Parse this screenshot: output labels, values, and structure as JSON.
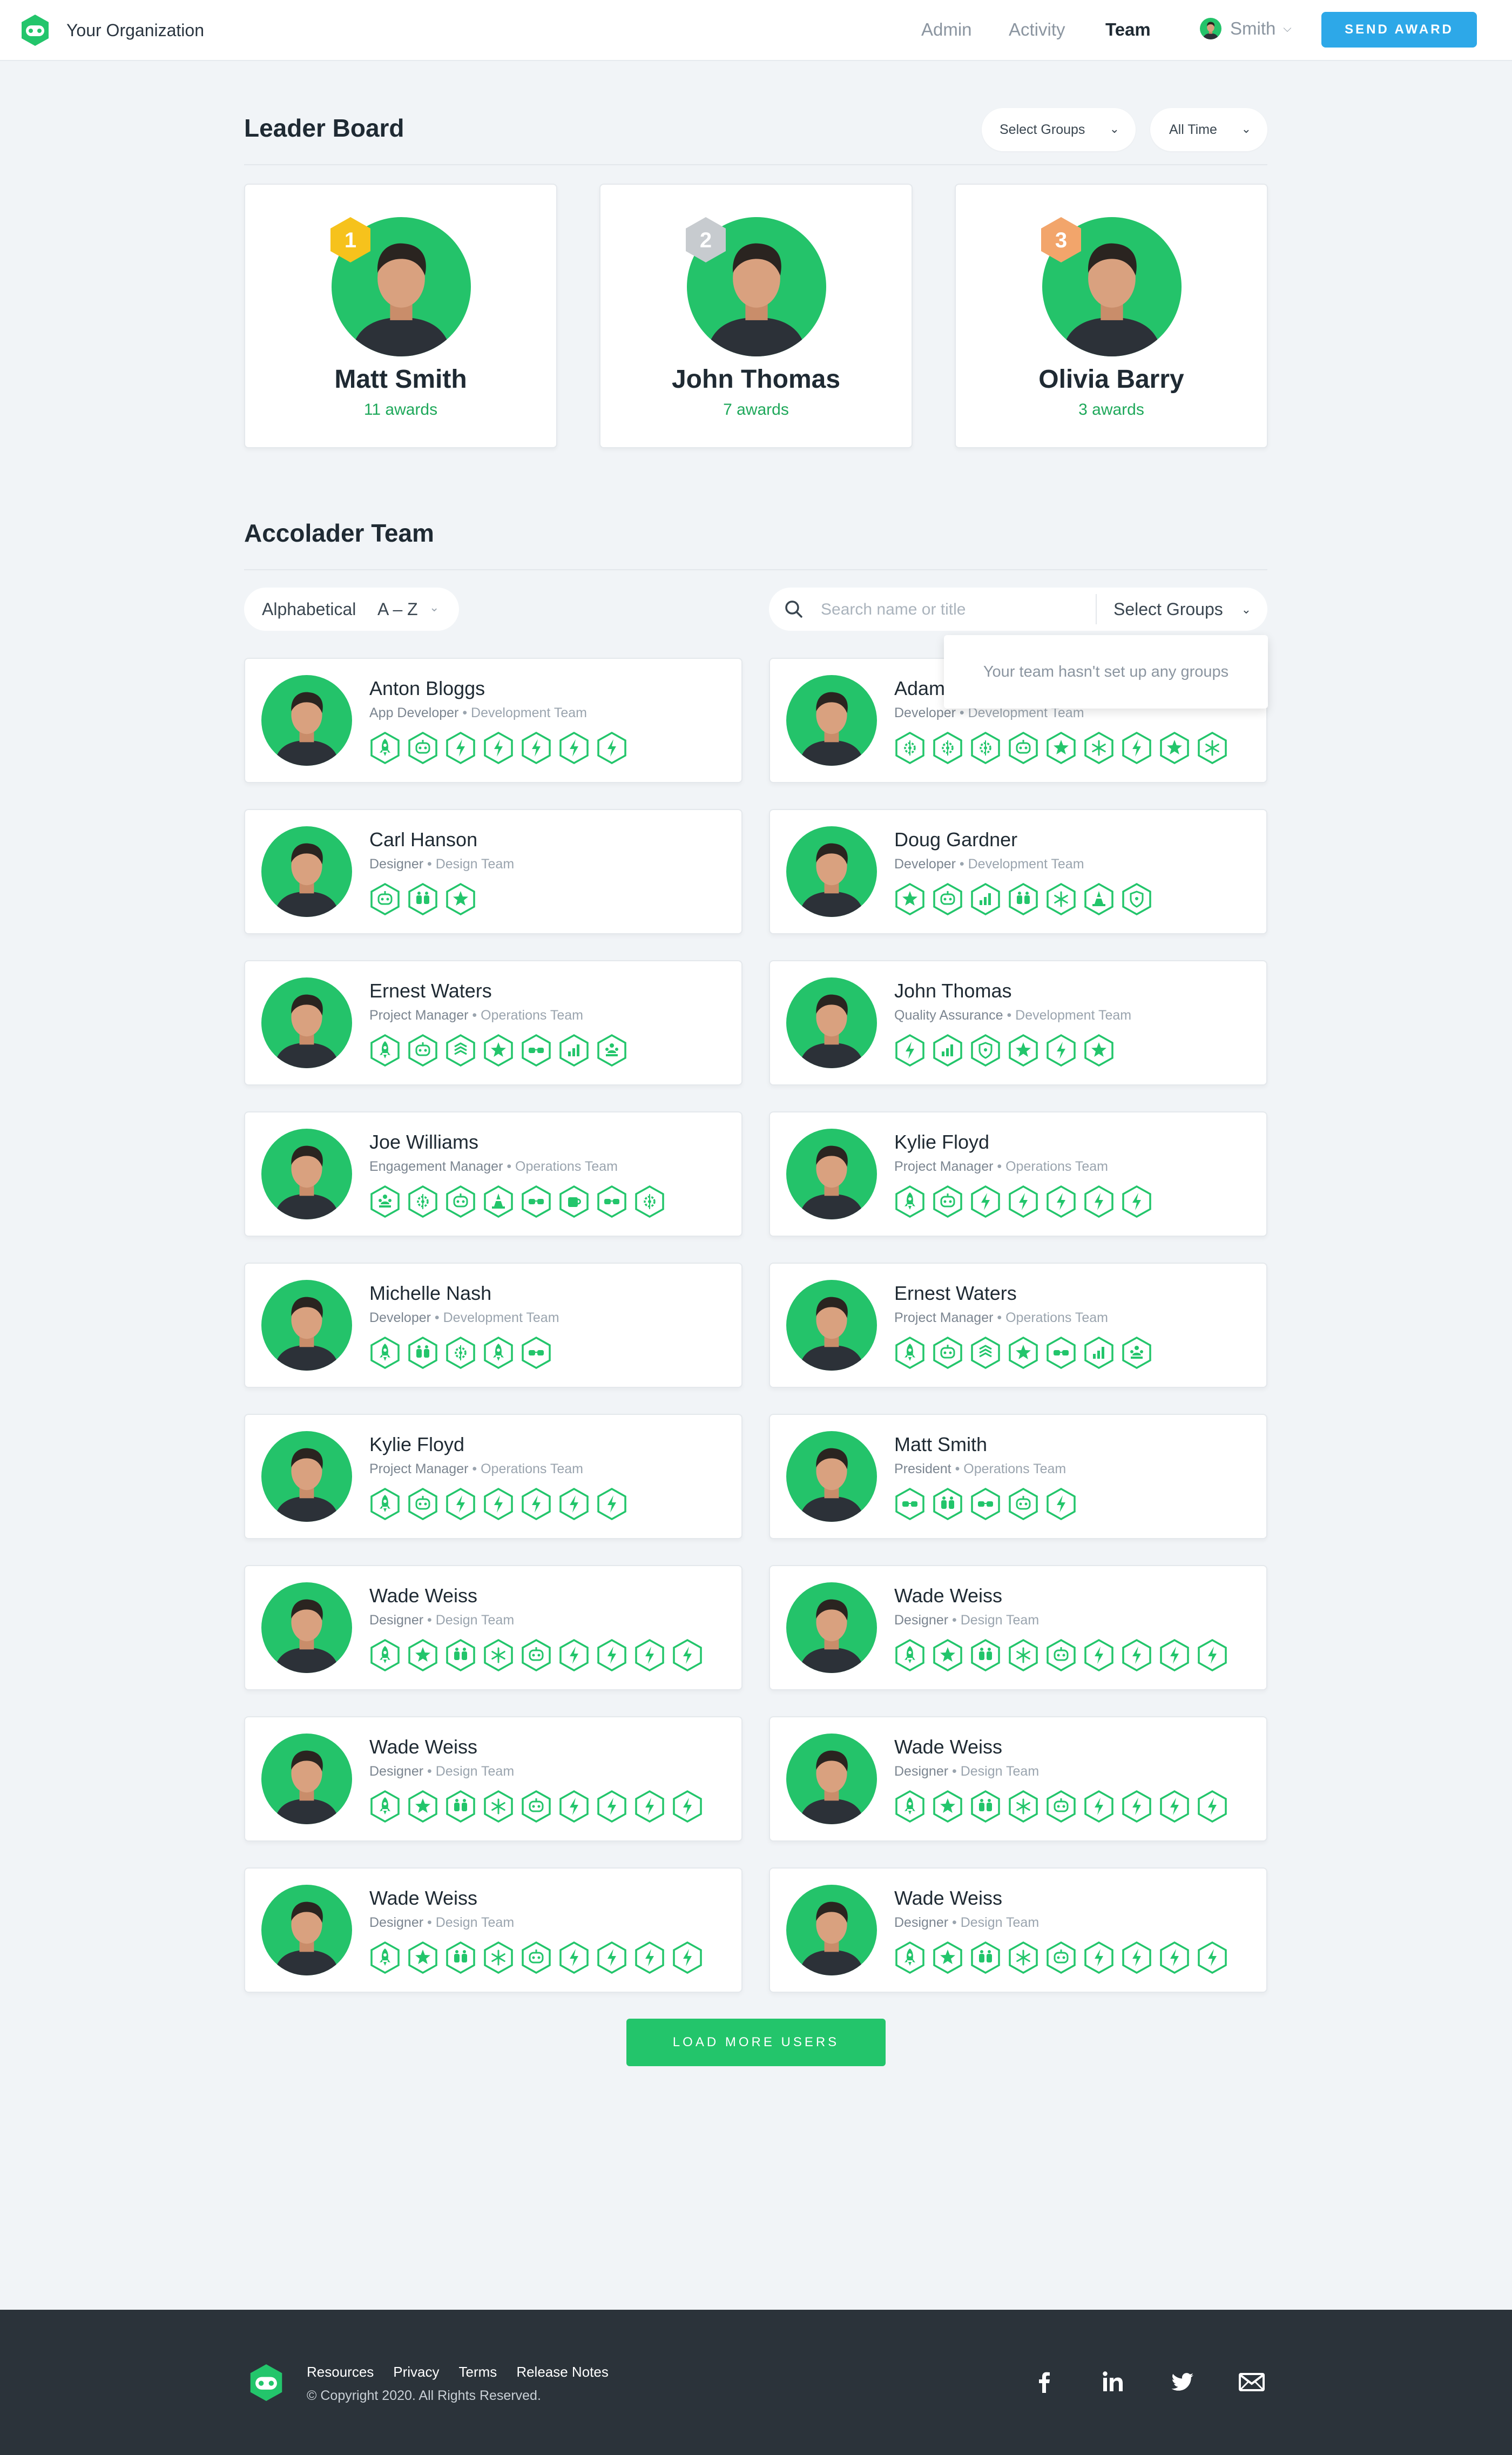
{
  "header": {
    "org_name": "Your Organization",
    "nav": [
      "Admin",
      "Activity",
      "Team"
    ],
    "active_nav": "Team",
    "user_name": "Smith",
    "send_award_label": "SEND AWARD"
  },
  "leaderboard": {
    "title": "Leader Board",
    "groups_filter": "Select Groups",
    "time_filter": "All Time",
    "leaders": [
      {
        "rank": "1",
        "name": "Matt Smith",
        "awards": "11 awards",
        "rank_color": "#f6c21c"
      },
      {
        "rank": "2",
        "name": "John Thomas",
        "awards": "7 awards",
        "rank_color": "#c7cbcf"
      },
      {
        "rank": "3",
        "name": "Olivia Barry",
        "awards": "3 awards",
        "rank_color": "#f2a56b"
      }
    ]
  },
  "team": {
    "title": "Accolader Team",
    "sort_label": "Alphabetical",
    "sort_value": "A – Z",
    "search_placeholder": "Search name or title",
    "groups_filter": "Select Groups",
    "groups_tooltip": "Your team hasn't set up any groups",
    "load_more_label": "LOAD MORE USERS",
    "members": [
      {
        "name": "Anton Bloggs",
        "title": "App Developer",
        "team": "Development Team",
        "badges": [
          "rocket",
          "robot",
          "bolt",
          "bolt",
          "bolt",
          "bolt",
          "bolt"
        ]
      },
      {
        "name": "Adam",
        "title": "Developer",
        "team": "Development Team",
        "badges": [
          "gear",
          "gear",
          "gear",
          "robot",
          "star",
          "snowflake",
          "bolt",
          "star",
          "snowflake"
        ]
      },
      {
        "name": "Carl Hanson",
        "title": "Designer",
        "team": "Design Team",
        "badges": [
          "robot",
          "hands",
          "star"
        ]
      },
      {
        "name": "Doug Gardner",
        "title": "Developer",
        "team": "Development Team",
        "badges": [
          "star",
          "robot",
          "chart",
          "hands",
          "snowflake",
          "cone",
          "shield"
        ]
      },
      {
        "name": "Ernest Waters",
        "title": "Project Manager",
        "team": "Operations Team",
        "badges": [
          "rocket",
          "robot",
          "layers",
          "star",
          "glasses",
          "chart",
          "people"
        ]
      },
      {
        "name": "John Thomas",
        "title": "Quality Assurance",
        "team": "Development Team",
        "badges": [
          "bolt",
          "chart",
          "shield",
          "star",
          "bolt",
          "star"
        ]
      },
      {
        "name": "Joe Williams",
        "title": "Engagement Manager",
        "team": "Operations Team",
        "badges": [
          "people",
          "gear",
          "robot",
          "cone",
          "glasses",
          "coffee",
          "glasses",
          "gear"
        ]
      },
      {
        "name": "Kylie Floyd",
        "title": "Project Manager",
        "team": "Operations Team",
        "badges": [
          "rocket",
          "robot",
          "bolt",
          "bolt",
          "bolt",
          "bolt",
          "bolt"
        ]
      },
      {
        "name": "Michelle Nash",
        "title": "Developer",
        "team": "Development Team",
        "badges": [
          "rocket",
          "hands",
          "gear",
          "rocket",
          "glasses"
        ]
      },
      {
        "name": "Ernest Waters",
        "title": "Project Manager",
        "team": "Operations Team",
        "badges": [
          "rocket",
          "robot",
          "layers",
          "star",
          "glasses",
          "chart",
          "people"
        ]
      },
      {
        "name": "Kylie Floyd",
        "title": "Project Manager",
        "team": "Operations Team",
        "badges": [
          "rocket",
          "robot",
          "bolt",
          "bolt",
          "bolt",
          "bolt",
          "bolt"
        ]
      },
      {
        "name": "Matt Smith",
        "title": "President",
        "team": "Operations Team",
        "badges": [
          "glasses",
          "hands",
          "glasses",
          "robot",
          "bolt"
        ]
      },
      {
        "name": "Wade Weiss",
        "title": "Designer",
        "team": "Design Team",
        "badges": [
          "rocket",
          "star",
          "hands",
          "snowflake",
          "robot",
          "bolt",
          "bolt",
          "bolt",
          "bolt"
        ]
      },
      {
        "name": "Wade Weiss",
        "title": "Designer",
        "team": "Design Team",
        "badges": [
          "rocket",
          "star",
          "hands",
          "snowflake",
          "robot",
          "bolt",
          "bolt",
          "bolt",
          "bolt"
        ]
      },
      {
        "name": "Wade Weiss",
        "title": "Designer",
        "team": "Design Team",
        "badges": [
          "rocket",
          "star",
          "hands",
          "snowflake",
          "robot",
          "bolt",
          "bolt",
          "bolt",
          "bolt"
        ]
      },
      {
        "name": "Wade Weiss",
        "title": "Designer",
        "team": "Design Team",
        "badges": [
          "rocket",
          "star",
          "hands",
          "snowflake",
          "robot",
          "bolt",
          "bolt",
          "bolt",
          "bolt"
        ]
      },
      {
        "name": "Wade Weiss",
        "title": "Designer",
        "team": "Design Team",
        "badges": [
          "rocket",
          "star",
          "hands",
          "snowflake",
          "robot",
          "bolt",
          "bolt",
          "bolt",
          "bolt"
        ]
      },
      {
        "name": "Wade Weiss",
        "title": "Designer",
        "team": "Design Team",
        "badges": [
          "rocket",
          "star",
          "hands",
          "snowflake",
          "robot",
          "bolt",
          "bolt",
          "bolt",
          "bolt"
        ]
      }
    ]
  },
  "footer": {
    "links": [
      "Resources",
      "Privacy",
      "Terms",
      "Release Notes"
    ],
    "copyright": "© Copyright 2020. All Rights Reserved.",
    "social": [
      "facebook-icon",
      "linkedin-icon",
      "twitter-icon",
      "mail-icon"
    ]
  },
  "colors": {
    "brand_green": "#23c56b",
    "accent_blue": "#2da8e8",
    "footer_bg": "#2b333a",
    "page_bg": "#f1f4f7"
  }
}
